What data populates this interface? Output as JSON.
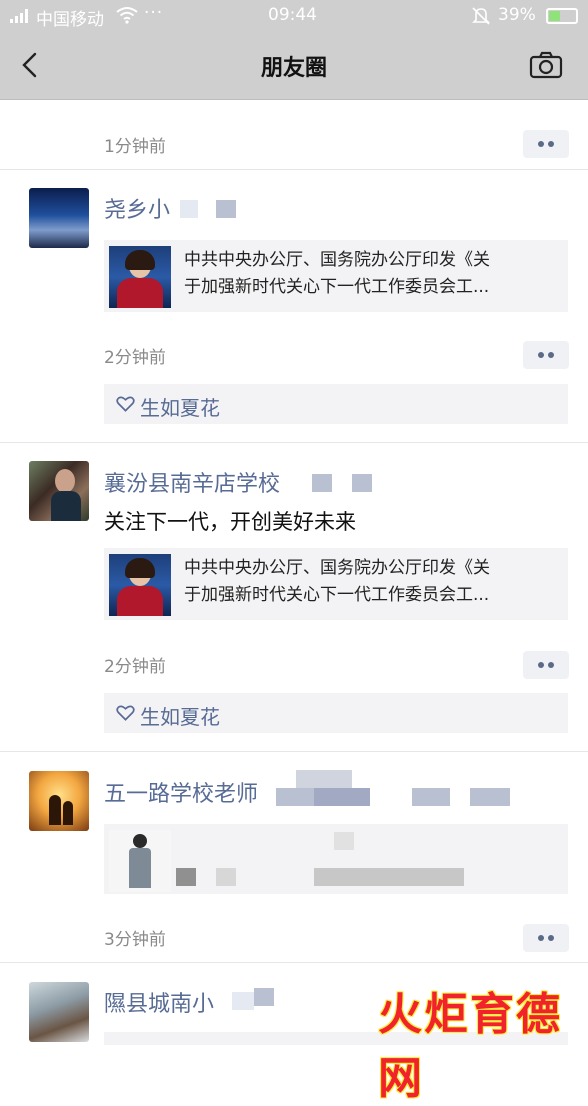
{
  "status_bar": {
    "carrier": "中国移动",
    "more_dots": "···",
    "time": "09:44",
    "battery_percent": "39%"
  },
  "nav": {
    "title": "朋友圈"
  },
  "feed": {
    "top_time": "1分钟前",
    "posts": [
      {
        "name": "尧乡小",
        "text": "",
        "link_line1": "中共中央办公厅、国务院办公厅印发《关",
        "link_line2": "于加强新时代关心下一代工作委员会工...",
        "time": "2分钟前",
        "like": "生如夏花"
      },
      {
        "name": "襄汾县南辛店学校",
        "text": "关注下一代，开创美好未来",
        "link_line1": "中共中央办公厅、国务院办公厅印发《关",
        "link_line2": "于加强新时代关心下一代工作委员会工...",
        "time": "2分钟前",
        "like": "生如夏花"
      },
      {
        "name": "五一路学校老师",
        "time": "3分钟前"
      },
      {
        "name": "隰县城南小"
      }
    ]
  },
  "watermark": "火炬育德网",
  "colors": {
    "bar_gray": "#cfcfcf",
    "name_blue": "#576b95",
    "card_bg": "#f3f3f5",
    "watermark_red": "#f0232d"
  },
  "icons": [
    "signal-icon",
    "wifi-icon",
    "mute-icon",
    "battery-icon",
    "back-icon",
    "camera-icon",
    "more-icon",
    "heart-icon"
  ]
}
